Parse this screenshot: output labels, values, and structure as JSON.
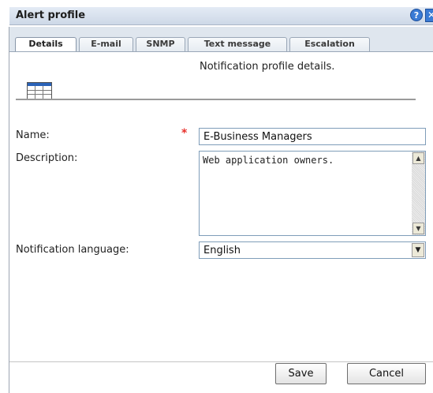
{
  "dialog": {
    "title": "Alert profile",
    "help_label": "?",
    "close_label": "✕"
  },
  "tabs": [
    {
      "label": "Details",
      "active": true
    },
    {
      "label": "E-mail",
      "active": false
    },
    {
      "label": "SNMP",
      "active": false
    },
    {
      "label": "Text message",
      "active": false
    },
    {
      "label": "Escalation",
      "active": false
    }
  ],
  "header": {
    "description": "Notification profile details.",
    "icon": "table-grid-icon"
  },
  "form": {
    "name_label": "Name:",
    "name_required_mark": "*",
    "name_value": "E-Business Managers",
    "description_label": "Description:",
    "description_value": "Web application owners.",
    "language_label": "Notification language:",
    "language_value": "English"
  },
  "buttons": {
    "save": "Save",
    "cancel": "Cancel"
  },
  "colors": {
    "required": "#e8312b",
    "title_accent": "#3a7bd5"
  }
}
